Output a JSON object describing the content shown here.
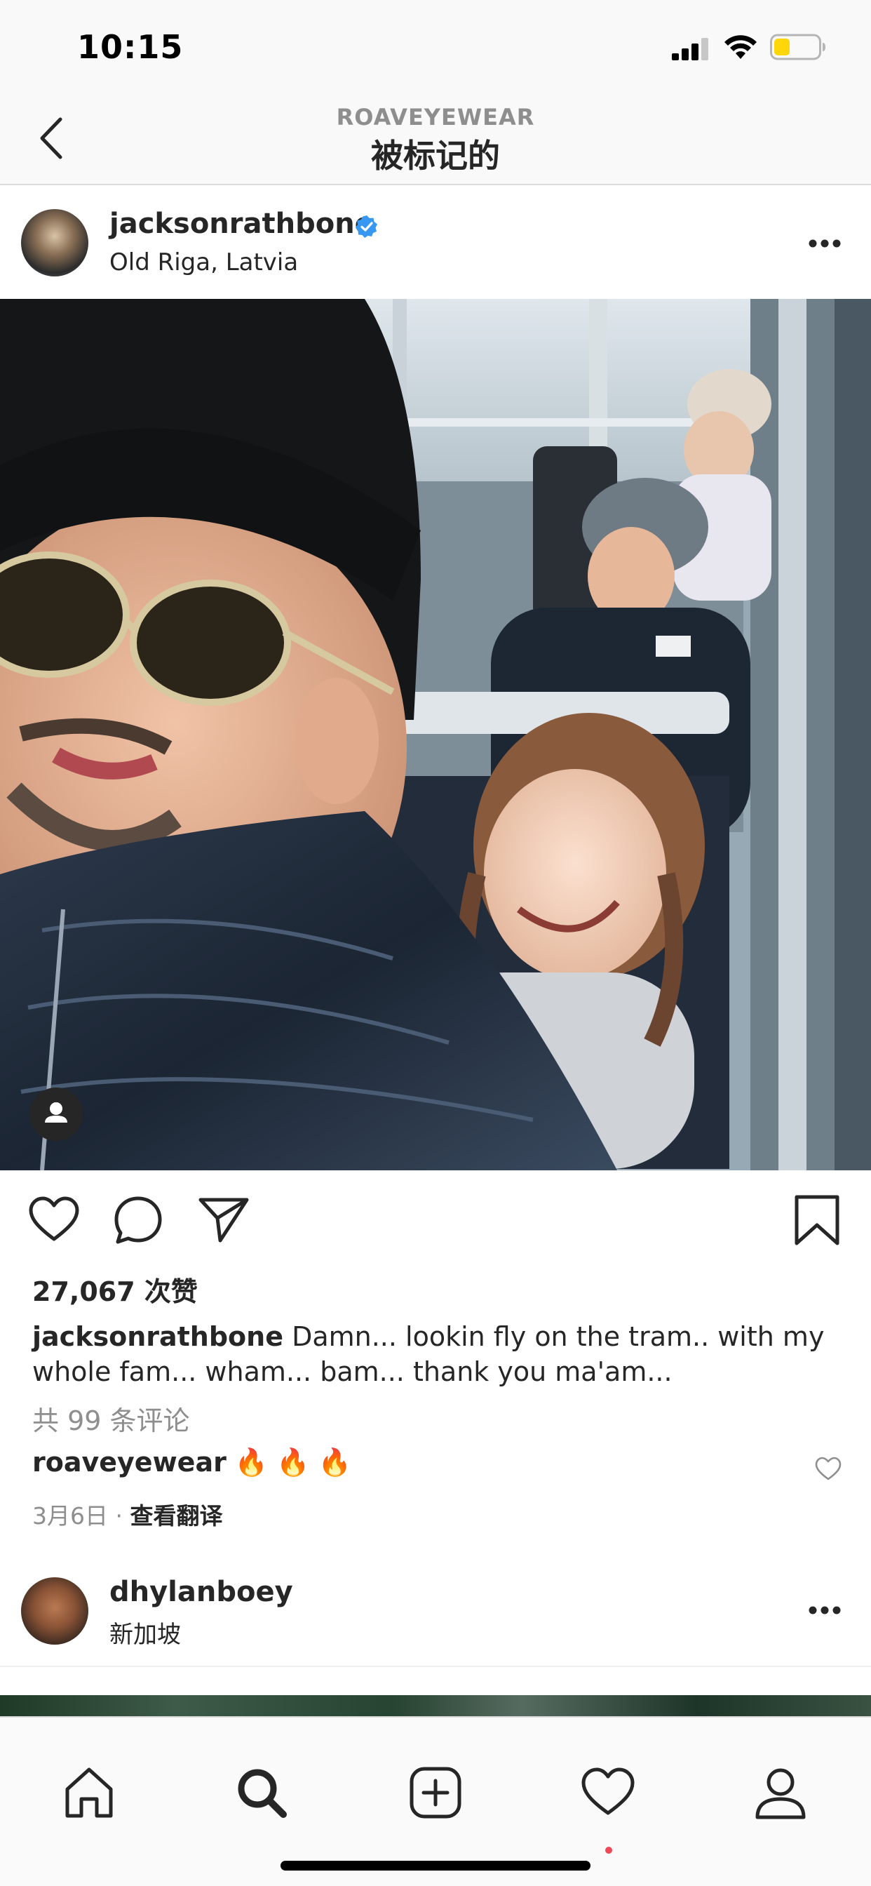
{
  "status_bar": {
    "time": "10:15"
  },
  "header": {
    "subtitle": "ROAVEYEWEAR",
    "title": "被标记的"
  },
  "post": {
    "username": "jacksonrathbone",
    "location": "Old Riga, Latvia",
    "likes": "27,067 次赞",
    "caption_user": "jacksonrathbone",
    "caption_text": " Damn... lookin fly on the tram.. with my whole fam... wham... bam... thank you ma'am...",
    "view_comments": "共 99 条评论",
    "comment": {
      "user": "roaveyewear",
      "text": " 🔥 🔥 🔥"
    },
    "date": "3月6日",
    "separator": " · ",
    "translate": "查看翻译"
  },
  "next_post": {
    "username": "dhylanboey",
    "location": "新加坡"
  },
  "icons": {
    "back": "chevron-left-icon",
    "verified": "verified-badge-icon",
    "more": "more-horizontal-icon",
    "like": "heart-icon",
    "comment": "comment-bubble-icon",
    "share": "send-icon",
    "save": "bookmark-icon",
    "tags": "user-tag-icon",
    "tabs": [
      "home-icon",
      "search-icon",
      "add-post-icon",
      "activity-heart-icon",
      "profile-icon"
    ]
  },
  "colors": {
    "verified": "#3897f0",
    "battery": "#ffd60a",
    "notification": "#ed4956",
    "muted": "#8e8e8e"
  }
}
